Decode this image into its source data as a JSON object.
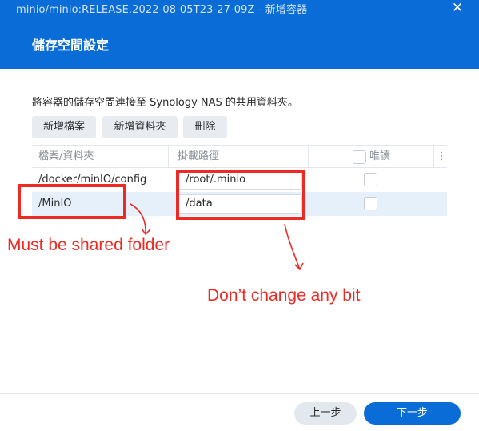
{
  "window": {
    "title": "minio/minio:RELEASE.2022-08-05T23-27-09Z - 新增容器",
    "close_glyph": "✕",
    "header_color": "#0a6cd6"
  },
  "section": {
    "title": "儲存空間設定"
  },
  "description": "將容器的儲存空間連接至 Synology NAS 的共用資料夾。",
  "toolbar": {
    "add_file": "新增檔案",
    "add_folder": "新增資料夾",
    "delete": "刪除"
  },
  "table": {
    "headers": {
      "path": "檔案/資料夾",
      "mount": "掛載路徑",
      "readonly": "唯讀",
      "more_glyph": "⋮"
    },
    "rows": [
      {
        "path": "/docker/minIO/config",
        "mount": "/root/.minio",
        "readonly": false,
        "selected": false
      },
      {
        "path": "/MinIO",
        "mount": "/data",
        "readonly": false,
        "selected": true
      }
    ]
  },
  "annotations": {
    "note1": "Must be shared folder",
    "note2": "Don’t change any bit",
    "color": "#ee2a24"
  },
  "footer": {
    "prev": "上一步",
    "next": "下一步",
    "accent": "#0a6cd6"
  }
}
